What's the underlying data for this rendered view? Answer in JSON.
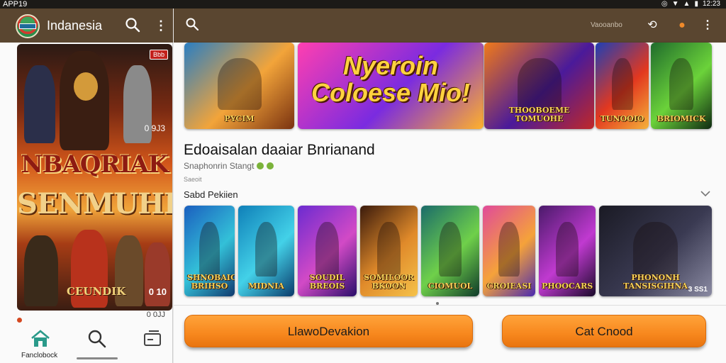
{
  "status_bar": {
    "left_text": "APP19",
    "time": "12:23"
  },
  "left_panel": {
    "app_title": "Indanesia",
    "poster": {
      "badge": "Bbb",
      "count": "0 9J3",
      "title_line1": "NBAQRIAK",
      "title_line2": "SENMUHLS",
      "bottom_text": "CEUNDIK",
      "bottom_count": "0 10"
    },
    "meta_text": "0 0JJ",
    "nav": {
      "home_label": "Fanclobock"
    }
  },
  "right_panel": {
    "header_text": "Vaooanbo",
    "top_row": [
      {
        "label": "PYCIM",
        "colors": [
          "#2a7ec2",
          "#f2a43a",
          "#7a3210"
        ]
      },
      {
        "label": "Nyeroin Coloese Mio!",
        "colors": [
          "#ff3fb0",
          "#7a2be0",
          "#ffb12a"
        ]
      },
      {
        "label": "THOOBOEME TOMUOHE",
        "colors": [
          "#f07a1a",
          "#4a1a9a",
          "#c02828"
        ]
      },
      {
        "label": "TUNOOIO",
        "colors": [
          "#1f3fb5",
          "#e2381f",
          "#f5b23a"
        ]
      },
      {
        "label": "BRIOMICK",
        "colors": [
          "#1f6b2c",
          "#6bd23a",
          "#0f2a12"
        ]
      }
    ],
    "section_title": "Edoaisalan daaiar Bnrianand",
    "section_subtitle": "Snaphonrin Stangt",
    "section_tiny": "Saeoit",
    "row_title": "Sabd Pekiien",
    "bottom_row": [
      {
        "label": "SHNOBAIC BRIHSO",
        "colors": [
          "#1b5fbf",
          "#33c0d8",
          "#103a6e"
        ]
      },
      {
        "label": "MIDNIA",
        "colors": [
          "#0f7fb8",
          "#43d1e8",
          "#0a3a6a"
        ]
      },
      {
        "label": "SOUDIL BREOIS",
        "colors": [
          "#6b2bd0",
          "#d24ac6",
          "#2a0e6a"
        ]
      },
      {
        "label": "SOMILOOR BKOON",
        "colors": [
          "#3a1a0c",
          "#e08a2a",
          "#f5c24a"
        ]
      },
      {
        "label": "CIOMUOL",
        "colors": [
          "#1a6b6a",
          "#6fd04a",
          "#0f3a2a"
        ]
      },
      {
        "label": "CROIEASI",
        "colors": [
          "#e04a9a",
          "#f5a23a",
          "#4a2ab0"
        ]
      },
      {
        "label": "PHOOCARS",
        "colors": [
          "#4a1a6a",
          "#c03ad0",
          "#1a0a2a"
        ]
      },
      {
        "label": "PHONONH TANSISGIHNA",
        "count": "3 SS1",
        "colors": [
          "#1a1a24",
          "#3a3a52",
          "#8a8aa2"
        ]
      }
    ],
    "buttons": {
      "primary": "LlawoDevakion",
      "secondary": "Cat Cnood"
    }
  }
}
